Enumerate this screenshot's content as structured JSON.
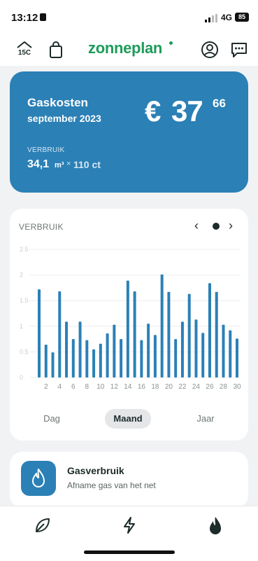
{
  "status_bar": {
    "time": "13:12",
    "network": "4G",
    "battery": "85"
  },
  "header": {
    "brand": "zonneplan",
    "temperature_label": "15C",
    "icons": [
      "house-temperature-icon",
      "shopping-bag-icon",
      "user-profile-icon",
      "chat-icon"
    ],
    "brand_color": "#1e9b5a"
  },
  "cost_card": {
    "title": "Gaskosten",
    "period": "september 2023",
    "currency": "€",
    "amount_int": "37",
    "amount_dec": "66",
    "usage_label": "VERBRUIK",
    "usage_amount": "34,1",
    "usage_unit": "m³",
    "times": "×",
    "usage_price": "110 ct",
    "color": "#2b80b6"
  },
  "chart": {
    "header_label": "VERBRUIK",
    "nav_prev": "‹",
    "nav_next": "›"
  },
  "chart_data": {
    "type": "bar",
    "x": [
      1,
      2,
      3,
      4,
      5,
      6,
      7,
      8,
      9,
      10,
      11,
      12,
      13,
      14,
      15,
      16,
      17,
      18,
      19,
      20,
      21,
      22,
      23,
      24,
      25,
      26,
      27,
      28,
      29,
      30
    ],
    "values": [
      1.72,
      0.64,
      0.49,
      1.68,
      1.09,
      0.75,
      1.09,
      0.73,
      0.55,
      0.66,
      0.86,
      1.03,
      0.75,
      1.89,
      1.68,
      0.73,
      1.05,
      0.83,
      2.01,
      1.67,
      0.75,
      1.09,
      1.63,
      1.13,
      0.87,
      1.84,
      1.67,
      1.03,
      0.92,
      0.76
    ],
    "x_tick_labels": [
      "2",
      "4",
      "6",
      "8",
      "10",
      "12",
      "14",
      "16",
      "18",
      "20",
      "22",
      "24",
      "26",
      "28",
      "30"
    ],
    "y_tick_labels": [
      "0",
      "0.5",
      "1",
      "1.5",
      "2",
      "2.5"
    ],
    "ylim": [
      0,
      2.5
    ],
    "grid": true,
    "bar_color": "#2b80b6"
  },
  "period_tabs": [
    {
      "label": "Dag",
      "active": false
    },
    {
      "label": "Maand",
      "active": true
    },
    {
      "label": "Jaar",
      "active": false
    }
  ],
  "gas_card": {
    "title": "Gasverbruik",
    "subtitle": "Afname gas van het net",
    "icon": "flame-icon"
  },
  "bottom_nav": {
    "items": [
      "leaf-icon",
      "lightning-icon",
      "flame-icon"
    ],
    "active": "flame-icon"
  }
}
